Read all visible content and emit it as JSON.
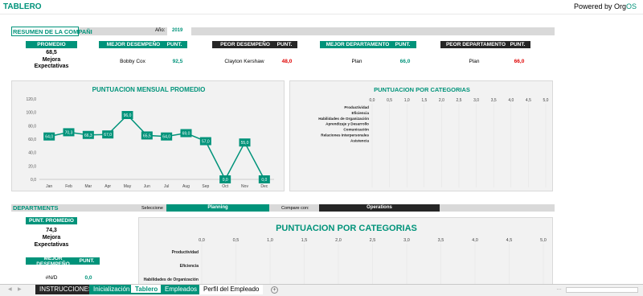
{
  "header": {
    "title": "TABLERO",
    "powered_by": "Powered by Org",
    "powered_brand": "OS"
  },
  "summary": {
    "section_title": "RESUMEN DE LA COMPAÑI",
    "year_label": "Año:",
    "year_value": "2019",
    "promedio": {
      "label": "PROMEDIO",
      "value": "68,5",
      "text_line1": "Mejora",
      "text_line2": "Expectativas"
    },
    "mejor_desempeno": {
      "label": "MEJOR DESEMPEÑO",
      "punt_label": "PUNT.",
      "name": "Bobby Cox",
      "score": "92,5"
    },
    "peor_desempeno": {
      "label": "PEOR DESEMPEÑO",
      "punt_label": "PUNT.",
      "name": "Clayton Kershaw",
      "score": "48,0"
    },
    "mejor_departamento": {
      "label": "MEJOR DEPARTAMENTO",
      "punt_label": "PUNT.",
      "name": "Plan",
      "score": "66,0"
    },
    "peor_departamento": {
      "label": "PEOR DEPARTAMENTO",
      "punt_label": "PUNT.",
      "name": "Plan",
      "score": "66,0"
    }
  },
  "chart_data": [
    {
      "type": "line",
      "title": "PUNTUACION MENSUAL PROMEDIO",
      "categories": [
        "Jan",
        "Feb",
        "Mar",
        "Apr",
        "May",
        "Jun",
        "Jul",
        "Aug",
        "Sep",
        "Oct",
        "Nov",
        "Dec"
      ],
      "values": [
        64.0,
        70.3,
        66.3,
        67.0,
        96.0,
        65.5,
        64.0,
        69.0,
        57.0,
        0.0,
        55.0,
        0.0
      ],
      "data_labels": [
        "64,0",
        "70,3",
        "66,3",
        "67,0",
        "96,0",
        "65,5",
        "64,0",
        "69,0",
        "57,0",
        "0,0",
        "55,0",
        "0,0"
      ],
      "y_ticks": [
        "0,0",
        "20,0",
        "40,0",
        "60,0",
        "80,0",
        "100,0",
        "120,0"
      ],
      "ylim": [
        0,
        120
      ],
      "color": "#00937a",
      "grid": false
    },
    {
      "type": "bar",
      "title": "PUNTUACION POR CATEGORIAS",
      "categories": [
        "Productividad",
        "Eficiencia",
        "Habilidades de Organización",
        "Aprendizaje y Desarrollo",
        "Comunicación",
        "Relaciones Interpersonales",
        "Asistencia"
      ],
      "x_ticks": [
        "0,0",
        "0,5",
        "1,0",
        "1,5",
        "2,0",
        "2,5",
        "3,0",
        "3,5",
        "4,0",
        "4,5",
        "5,0"
      ],
      "xlim": [
        0,
        5
      ],
      "values": []
    },
    {
      "type": "bar",
      "title": "PUNTUACION POR CATEGORIAS",
      "categories": [
        "Productividad",
        "Eficiencia",
        "Habilidades de Organización"
      ],
      "x_ticks": [
        "0,0",
        "0,5",
        "1,0",
        "1,5",
        "2,0",
        "2,5",
        "3,0",
        "3,5",
        "4,0",
        "4,5",
        "5,0"
      ],
      "xlim": [
        0,
        5
      ],
      "values": []
    }
  ],
  "departments": {
    "section_title": "DEPARTMENTS",
    "select_label": "Seleccione",
    "select_value": "Planning",
    "compare_label": "Compare con:",
    "compare_value": "Operations",
    "punt_promedio": {
      "label": "PUNT. PROMEDIO",
      "value": "74,3",
      "text_line1": "Mejora",
      "text_line2": "Expectativas"
    },
    "mejor_desempeno": {
      "label": "MEJOR DESEMPEÑO",
      "punt_label": "PUNT.",
      "name": "#N/D",
      "score": "0,0"
    }
  },
  "tabs": [
    {
      "label": "INSTRUCCIONES"
    },
    {
      "label": "Inicialización"
    },
    {
      "label": "Tablero"
    },
    {
      "label": "Empleados"
    },
    {
      "label": "Perfil del Empleado"
    }
  ],
  "tab_controls": {
    "add": "+",
    "nav_prev": "◀",
    "nav_next": "▶",
    "more": "…"
  }
}
